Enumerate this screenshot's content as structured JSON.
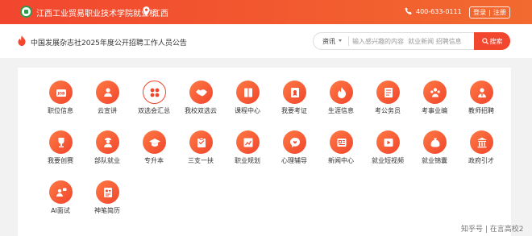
{
  "header": {
    "site_title": "江西工业贸易职业技术学院就业桥",
    "city": "江西",
    "phone": "400-633-0111",
    "login_label": "登录",
    "divider": "|",
    "register_label": "注册",
    "logo_icon": "college-logo-icon",
    "location_icon": "map-pin-icon",
    "phone_icon": "phone-icon"
  },
  "announcement": {
    "icon": "flame-icon",
    "text": "中国发展杂志社2025年度公开招聘工作人员公告"
  },
  "search": {
    "category": "资讯",
    "placeholder": "输入感兴趣的内容  就业新闻 招聘信息",
    "button_label": "搜索"
  },
  "menu": {
    "row1": [
      "职位信息",
      "云宣讲",
      "双选会汇总",
      "我校双选云",
      "课程中心",
      "我要考证",
      "生涯信息",
      "考公务员",
      "考事业编",
      "教师招聘"
    ],
    "row2": [
      "我要创赛",
      "部队就业",
      "专升本",
      "三支一扶",
      "职业规划",
      "心理辅导",
      "新闻中心",
      "就业短视频",
      "就业锦囊",
      "政府引才"
    ],
    "row3": [
      "AI面试",
      "神笔简历"
    ]
  },
  "watermark": "知乎号 | 在言高校2",
  "colors": {
    "brand_red": "#f2462f",
    "brand_orange": "#f26a2f"
  }
}
